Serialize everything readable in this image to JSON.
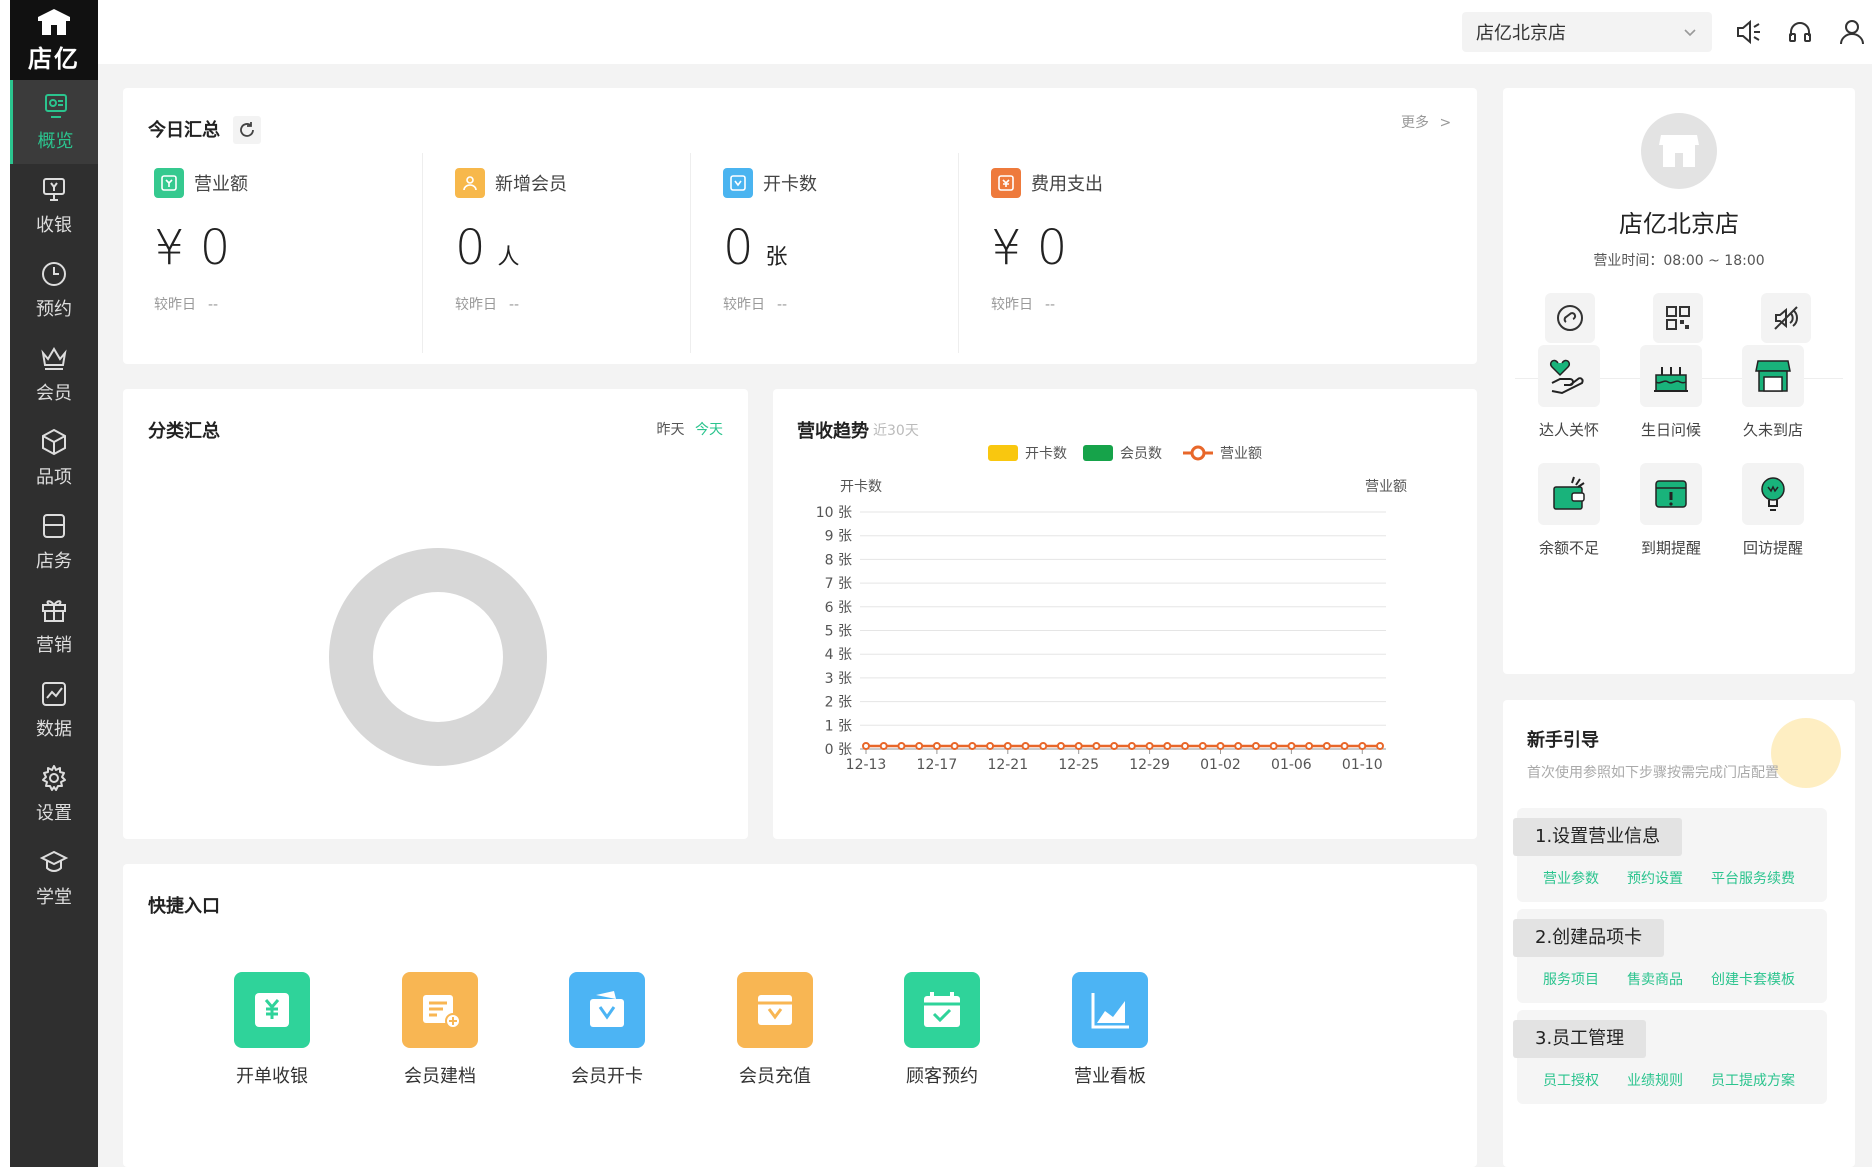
{
  "brand": {
    "name": "店亿"
  },
  "sidebar": {
    "items": [
      {
        "label": "概览",
        "icon": "overview-icon",
        "active": true
      },
      {
        "label": "收银",
        "icon": "cashier-icon"
      },
      {
        "label": "预约",
        "icon": "clock-icon"
      },
      {
        "label": "会员",
        "icon": "crown-icon"
      },
      {
        "label": "品项",
        "icon": "box-icon"
      },
      {
        "label": "店务",
        "icon": "store-task-icon"
      },
      {
        "label": "营销",
        "icon": "gift-icon"
      },
      {
        "label": "数据",
        "icon": "chart-icon"
      },
      {
        "label": "设置",
        "icon": "gear-icon"
      },
      {
        "label": "学堂",
        "icon": "graduation-cap-icon"
      }
    ]
  },
  "header": {
    "store_select": "店亿北京店",
    "icons": [
      "speaker-icon",
      "headset-icon",
      "user-icon"
    ]
  },
  "today": {
    "title": "今日汇总",
    "more": "更多",
    "stats": [
      {
        "label": "营业额",
        "value": "¥ 0",
        "unit": "",
        "compare_label": "较昨日",
        "compare_value": "--",
        "color": "#35c98f",
        "icon": "revenue-icon"
      },
      {
        "label": "新增会员",
        "value": "0",
        "unit": "人",
        "compare_label": "较昨日",
        "compare_value": "--",
        "color": "#f7b84b",
        "icon": "new-member-icon"
      },
      {
        "label": "开卡数",
        "value": "0",
        "unit": "张",
        "compare_label": "较昨日",
        "compare_value": "--",
        "color": "#4ab4f0",
        "icon": "card-icon"
      },
      {
        "label": "费用支出",
        "value": "¥ 0",
        "unit": "",
        "compare_label": "较昨日",
        "compare_value": "--",
        "color": "#ee7a3c",
        "icon": "expense-icon"
      }
    ]
  },
  "category": {
    "title": "分类汇总",
    "tabs": [
      "昨天",
      "今天"
    ],
    "active_tab": "今天"
  },
  "trend": {
    "title": "营收趋势",
    "subtitle": "近30天",
    "left_axis_title": "开卡数",
    "right_axis_title": "营业额"
  },
  "chart_data": {
    "type": "line",
    "title": "营收趋势",
    "subtitle": "近30天",
    "legend": [
      "开卡数",
      "会员数",
      "营业额"
    ],
    "legend_colors": [
      "#f9c70f",
      "#16a34a",
      "#e8672a"
    ],
    "ylabel": "开卡数",
    "y2label": "营业额",
    "ylim": [
      0,
      10
    ],
    "yticks": [
      "0 张",
      "1 张",
      "2 张",
      "3 张",
      "4 张",
      "5 张",
      "6 张",
      "7 张",
      "8 张",
      "9 张",
      "10 张"
    ],
    "xticks": [
      "12-13",
      "12-17",
      "12-21",
      "12-25",
      "12-29",
      "01-02",
      "01-06",
      "01-10"
    ],
    "x": [
      "12-13",
      "12-14",
      "12-15",
      "12-16",
      "12-17",
      "12-18",
      "12-19",
      "12-20",
      "12-21",
      "12-22",
      "12-23",
      "12-24",
      "12-25",
      "12-26",
      "12-27",
      "12-28",
      "12-29",
      "12-30",
      "12-31",
      "01-01",
      "01-02",
      "01-03",
      "01-04",
      "01-05",
      "01-06",
      "01-07",
      "01-08",
      "01-09",
      "01-10",
      "01-11"
    ],
    "series": [
      {
        "name": "营业额",
        "values": [
          0,
          0,
          0,
          0,
          0,
          0,
          0,
          0,
          0,
          0,
          0,
          0,
          0,
          0,
          0,
          0,
          0,
          0,
          0,
          0,
          0,
          0,
          0,
          0,
          0,
          0,
          0,
          0,
          0,
          0
        ]
      }
    ]
  },
  "quick": {
    "title": "快捷入口",
    "items": [
      {
        "label": "开单收银",
        "color": "#2fd39a",
        "icon": "cashier-order-icon"
      },
      {
        "label": "会员建档",
        "color": "#f8b653",
        "icon": "member-file-icon"
      },
      {
        "label": "会员开卡",
        "color": "#4cb4f4",
        "icon": "open-card-icon"
      },
      {
        "label": "会员充值",
        "color": "#f8b653",
        "icon": "recharge-icon"
      },
      {
        "label": "顾客预约",
        "color": "#2fd39a",
        "icon": "calendar-check-icon"
      },
      {
        "label": "营业看板",
        "color": "#4cb4f4",
        "icon": "dashboard-icon"
      }
    ]
  },
  "shop": {
    "name": "店亿北京店",
    "hours": "营业时间：08:00 ~ 18:00",
    "actions": [
      "mini-program-icon",
      "qr-code-icon",
      "voice-off-icon"
    ],
    "features": [
      {
        "label": "达人关怀",
        "icon": "care-icon"
      },
      {
        "label": "生日问候",
        "icon": "birthday-cake-icon"
      },
      {
        "label": "久未到店",
        "icon": "shop-icon"
      },
      {
        "label": "余额不足",
        "icon": "wallet-icon"
      },
      {
        "label": "到期提醒",
        "icon": "expire-icon"
      },
      {
        "label": "回访提醒",
        "icon": "bulb-icon"
      }
    ]
  },
  "guide": {
    "title": "新手引导",
    "subtitle": "首次使用参照如下步骤按需完成门店配置",
    "steps": [
      {
        "label": "1.设置营业信息",
        "links": [
          "营业参数",
          "预约设置",
          "平台服务续费"
        ]
      },
      {
        "label": "2.创建品项卡",
        "links": [
          "服务项目",
          "售卖商品",
          "创建卡套模板"
        ]
      },
      {
        "label": "3.员工管理",
        "links": [
          "员工授权",
          "业绩规则",
          "员工提成方案"
        ]
      }
    ]
  }
}
